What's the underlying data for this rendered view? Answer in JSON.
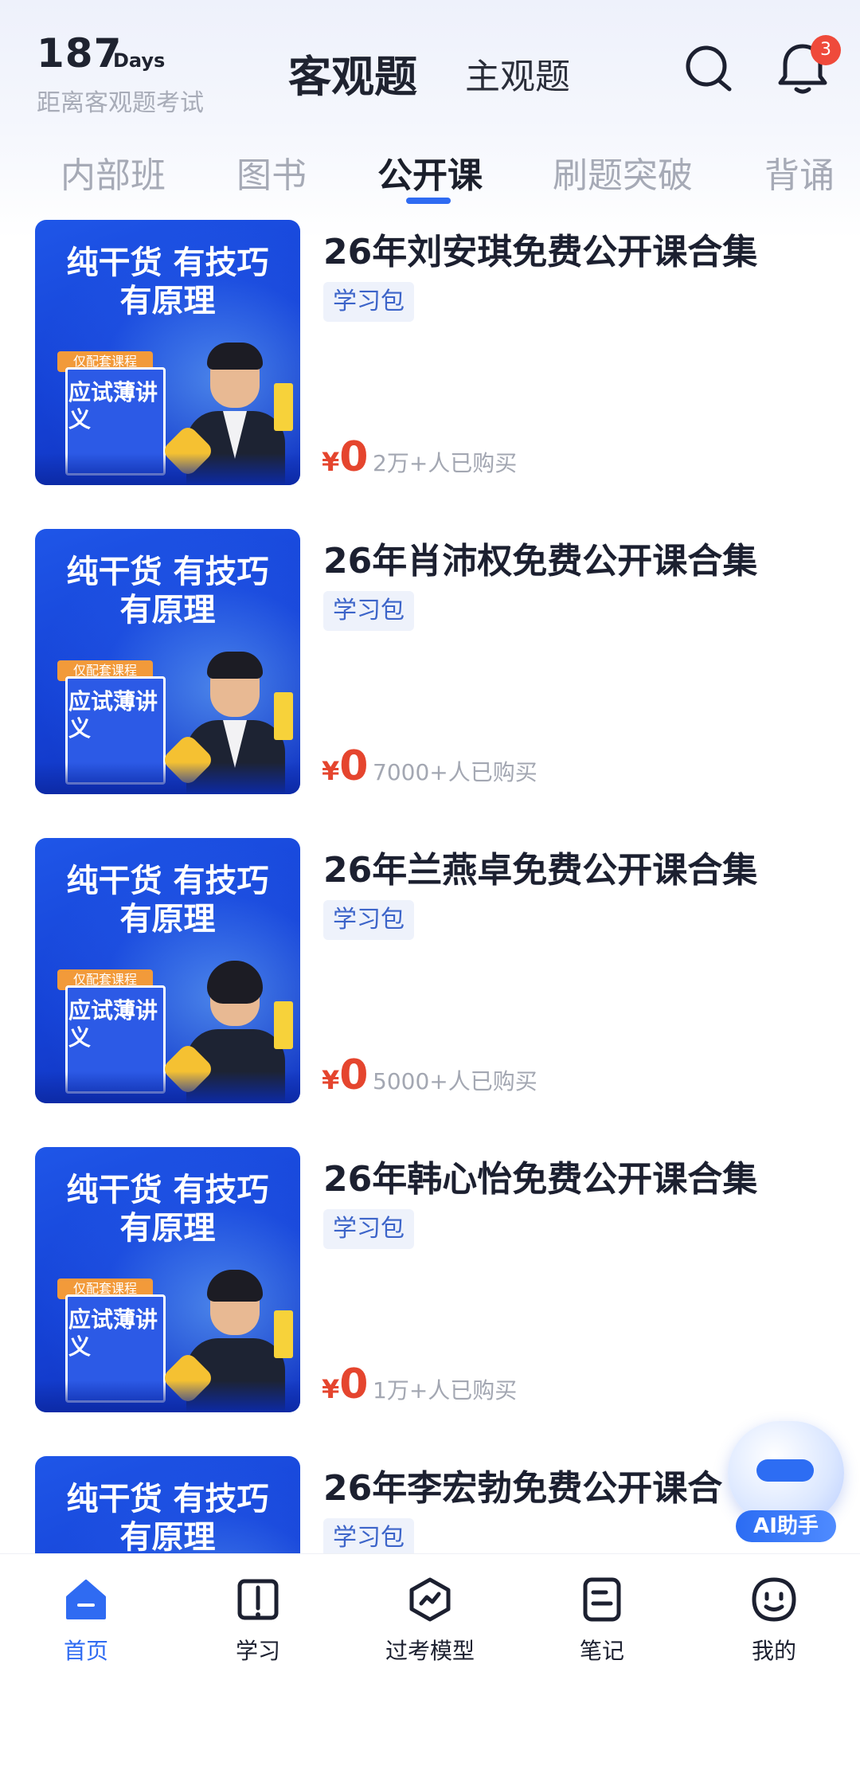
{
  "header": {
    "days_count": "187",
    "days_unit": "Days",
    "days_subtitle": "距离客观题考试",
    "tab_objective": "客观题",
    "tab_subjective": "主观题",
    "notification_count": "3"
  },
  "categories": [
    {
      "label": "内部班"
    },
    {
      "label": "图书"
    },
    {
      "label": "公开课",
      "active": true
    },
    {
      "label": "刷题突破"
    },
    {
      "label": "背诵"
    }
  ],
  "thumb": {
    "slogan_line1": "纯干货 有技巧",
    "slogan_line2": "有原理",
    "book_tag": "仅配套课程",
    "book_title": "应试薄讲义"
  },
  "courses": [
    {
      "title": "26年刘安琪免费公开课合集",
      "tag": "学习包",
      "currency": "¥",
      "price": "0",
      "sales": "2万+人已购买"
    },
    {
      "title": "26年肖沛权免费公开课合集",
      "tag": "学习包",
      "currency": "¥",
      "price": "0",
      "sales": "7000+人已购买"
    },
    {
      "title": "26年兰燕卓免费公开课合集",
      "tag": "学习包",
      "currency": "¥",
      "price": "0",
      "sales": "5000+人已购买"
    },
    {
      "title": "26年韩心怡免费公开课合集",
      "tag": "学习包",
      "currency": "¥",
      "price": "0",
      "sales": "1万+人已购买"
    },
    {
      "title": "26年李宏勃免费公开课合",
      "tag": "学习包",
      "currency": "",
      "price": "",
      "sales": ""
    }
  ],
  "ai_helper": {
    "label": "AI助手"
  },
  "bottom_nav": [
    {
      "label": "首页",
      "icon": "home-icon",
      "active": true
    },
    {
      "label": "学习",
      "icon": "book-icon"
    },
    {
      "label": "过考模型",
      "icon": "model-icon"
    },
    {
      "label": "笔记",
      "icon": "note-icon"
    },
    {
      "label": "我的",
      "icon": "profile-icon"
    }
  ],
  "colors": {
    "accent": "#2f6bf2",
    "price": "#e5452e",
    "badge": "#ef4a3b",
    "tag_bg": "#eef2fb",
    "tag_text": "#3c64c9"
  }
}
